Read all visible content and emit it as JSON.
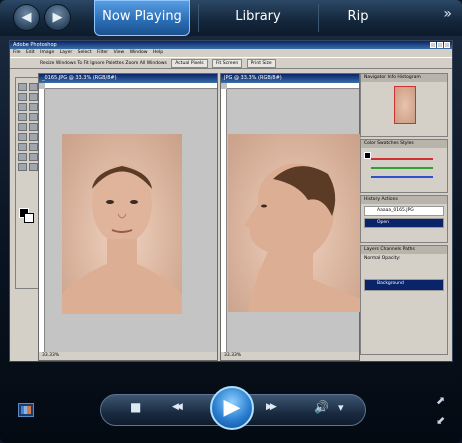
{
  "player": {
    "tabs": [
      "Now Playing",
      "Library",
      "Rip"
    ],
    "back_icon": "back-arrow-icon",
    "forward_icon": "forward-arrow-icon",
    "more_icon": "double-chevron-icon",
    "more_glyph": "»"
  },
  "photoshop": {
    "title": "Adobe Photoshop",
    "menu": [
      "File",
      "Edit",
      "Image",
      "Layer",
      "Select",
      "Filter",
      "View",
      "Window",
      "Help"
    ],
    "options": [
      "Resize Windows To Fit",
      "Ignore Palettes",
      "Zoom All Windows",
      "Actual Pixels",
      "Fit Screen",
      "Print Size"
    ],
    "doc1": {
      "title": "_0165.JPG @ 33.3% (RGB/8#)",
      "status": "33.33%"
    },
    "doc2": {
      "title": "JPG @ 33.3% (RGB/8#)",
      "status": "33.33%"
    },
    "navigator": {
      "tabs": "Navigator  Info  Histogram"
    },
    "color": {
      "tabs": "Color  Swatches  Styles"
    },
    "history": {
      "tabs": "History  Actions",
      "items": [
        "Aaaaa_0165.JPG",
        "Open"
      ]
    },
    "layers": {
      "tabs": "Layers  Channels  Paths",
      "mode": "Normal",
      "opacity_label": "Opacity:",
      "layer": "Background"
    }
  },
  "controls": {
    "stop": "■",
    "prev": "◀◀",
    "play": "▶",
    "next": "▶▶",
    "volume": "🔊",
    "volume_menu": "▾"
  },
  "colors": {
    "accent": "#2b6fb8",
    "play_button": "#2a7fd0"
  }
}
